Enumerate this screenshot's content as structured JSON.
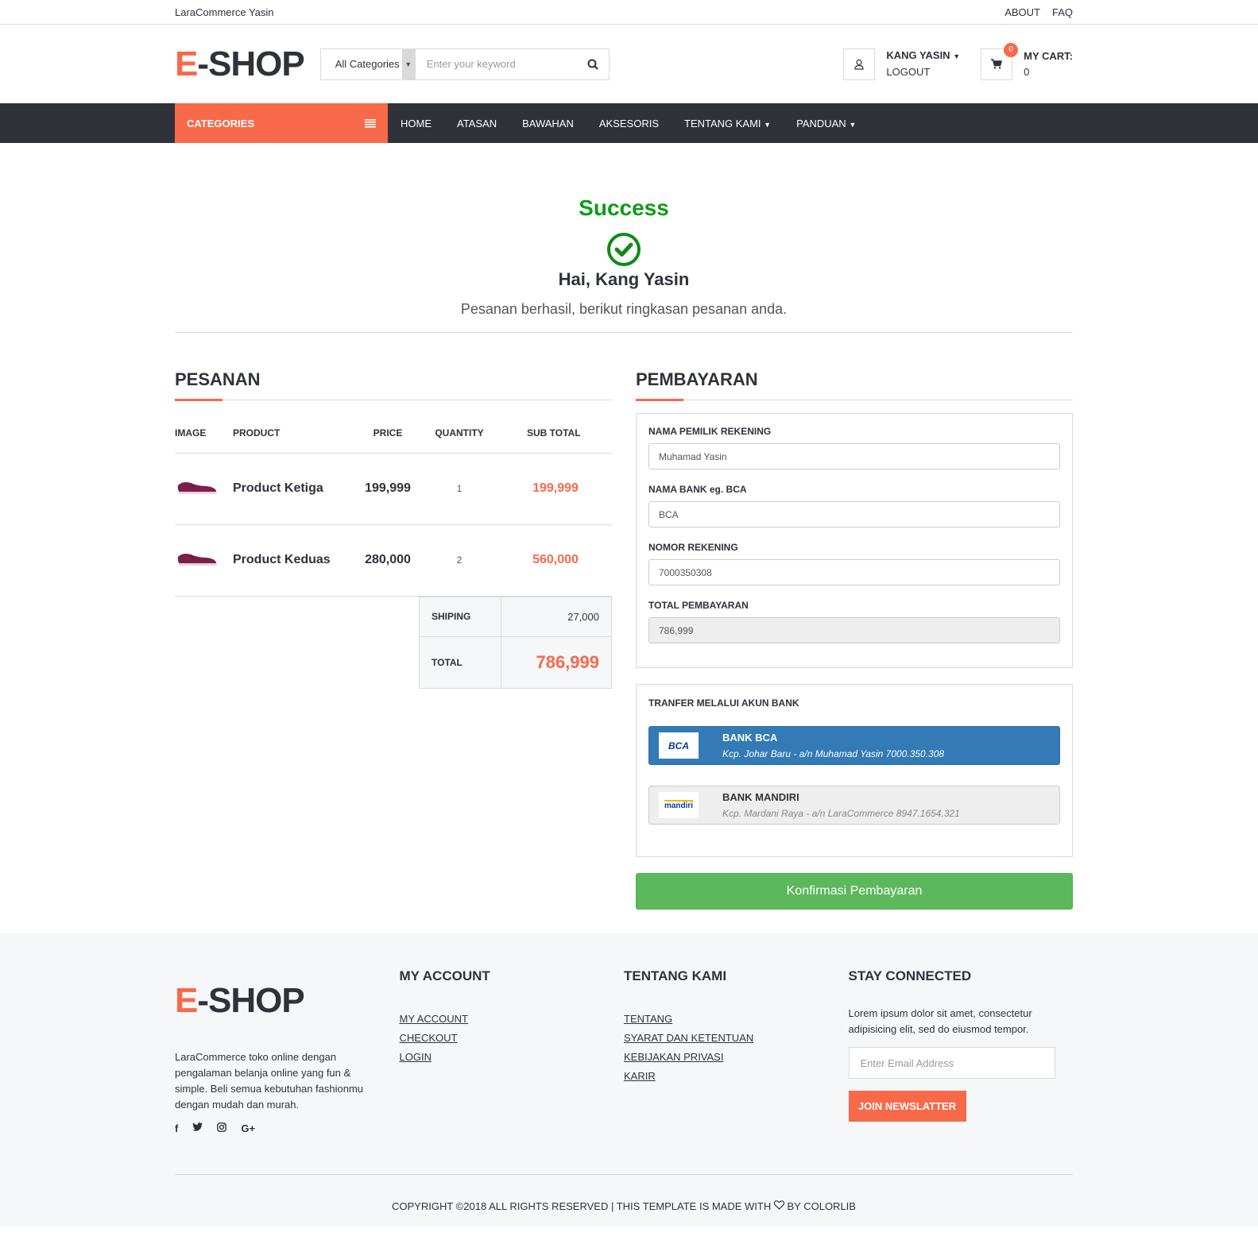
{
  "top_header": {
    "brand": "LaraCommerce Yasin",
    "links": [
      "ABOUT",
      "FAQ"
    ]
  },
  "header": {
    "logo_e": "E",
    "logo_rest": "-SHOP",
    "category_select": "All Categories",
    "search_placeholder": "Enter your keyword",
    "account_name": "KANG YASIN",
    "logout": "LOGOUT",
    "cart_label": "MY CART:",
    "cart_value": "0",
    "cart_badge": "0"
  },
  "nav": {
    "categories": "CATEGORIES",
    "items": [
      "HOME",
      "ATASAN",
      "BAWAHAN",
      "AKSESORIS",
      "TENTANG KAMI",
      "PANDUAN"
    ]
  },
  "success": {
    "title": "Success",
    "greeting": "Hai, Kang Yasin",
    "message": "Pesanan berhasil, berikut ringkasan pesanan anda."
  },
  "order": {
    "title": "PESANAN",
    "headers": [
      "IMAGE",
      "PRODUCT",
      "PRICE",
      "QUANTITY",
      "SUB TOTAL"
    ],
    "rows": [
      {
        "product": "Product Ketiga",
        "price": "199,999",
        "qty": "1",
        "subtotal": "199,999"
      },
      {
        "product": "Product Keduas",
        "price": "280,000",
        "qty": "2",
        "subtotal": "560,000"
      }
    ],
    "shipping_label": "SHIPING",
    "shipping_value": "27,000",
    "total_label": "TOTAL",
    "total_value": "786,999"
  },
  "payment": {
    "title": "PEMBAYARAN",
    "owner_label": "NAMA PEMILIK REKENING",
    "owner_value": "Muhamad Yasin",
    "bank_label": "NAMA BANK eg. BCA",
    "bank_value": "BCA",
    "account_label": "NOMOR REKENING",
    "account_value": "7000350308",
    "total_label": "TOTAL PEMBAYARAN",
    "total_value": "786,999",
    "transfer_title": "TRANFER MELALUI AKUN BANK",
    "banks": [
      {
        "name": "BANK BCA",
        "desc": "Kcp. Johar Baru - a/n Muhamad Yasin 7000.350.308",
        "logo_text": "BCA"
      },
      {
        "name": "BANK MANDIRI",
        "desc": "Kcp. Mardani Raya - a/n LaraCommerce 8947.1654.321",
        "logo_text": "mandiri"
      }
    ],
    "confirm": "Konfirmasi Pembayaran"
  },
  "footer": {
    "description": "LaraCommerce toko online dengan pengalaman belanja online yang fun & simple. Beli semua kebutuhan fashionmu dengan mudah dan murah.",
    "my_account_title": "MY ACCOUNT",
    "my_account_links": [
      "MY ACCOUNT",
      "CHECKOUT",
      "LOGIN"
    ],
    "tentang_title": "TENTANG KAMI",
    "tentang_links": [
      "TENTANG",
      "SYARAT DAN KETENTUAN",
      "KEBIJAKAN PRIVASI",
      "KARIR"
    ],
    "stay_title": "STAY CONNECTED",
    "stay_text": "Lorem ipsum dolor sit amet, consectetur adipisicing elit, sed do eiusmod tempor.",
    "email_placeholder": "Enter Email Address",
    "join": "JOIN NEWSLATTER",
    "copyright_pre": "COPYRIGHT ©2018 ALL RIGHTS RESERVED | THIS TEMPLATE IS MADE WITH",
    "copyright_post": "BY COLORLIB"
  },
  "colors": {
    "accent": "#F8694A",
    "dark": "#30323a",
    "success": "#0f9b16",
    "bank_active": "#337ab7",
    "confirm": "#5cb85c"
  }
}
